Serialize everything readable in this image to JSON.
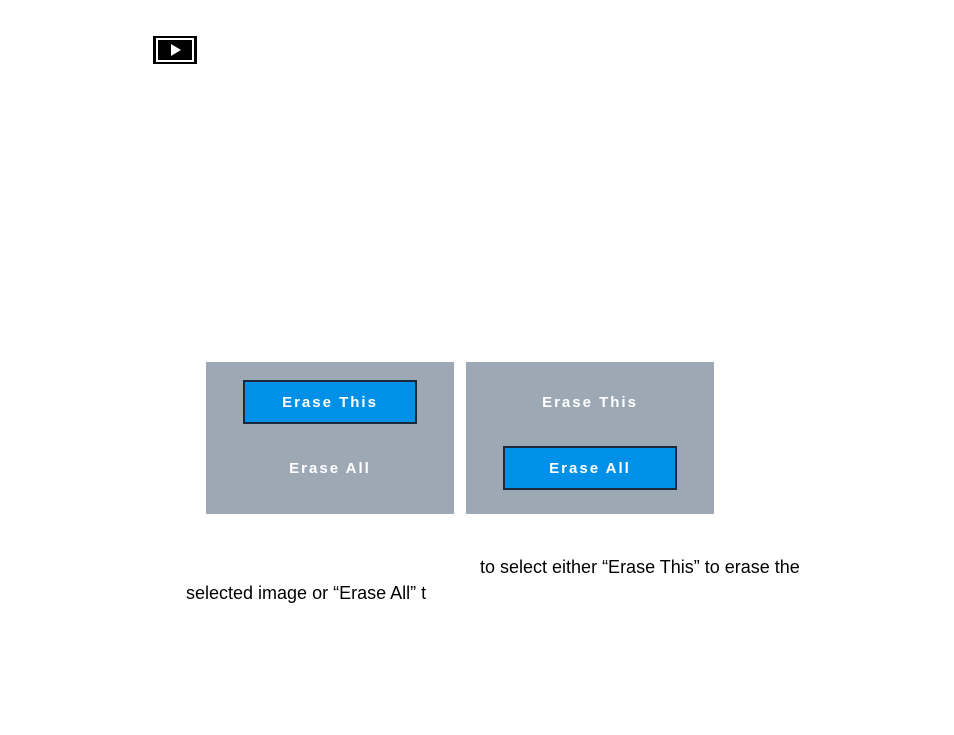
{
  "icon_name": "playback-icon",
  "panels": [
    {
      "options": [
        {
          "label": "Erase This",
          "selected": true
        },
        {
          "label": "Erase All",
          "selected": false
        }
      ]
    },
    {
      "options": [
        {
          "label": "Erase This",
          "selected": false
        },
        {
          "label": "Erase All",
          "selected": true
        }
      ]
    }
  ],
  "instruction": {
    "line1": "to select either “Erase This” to erase the",
    "line2": "selected image or “Erase All” t"
  }
}
